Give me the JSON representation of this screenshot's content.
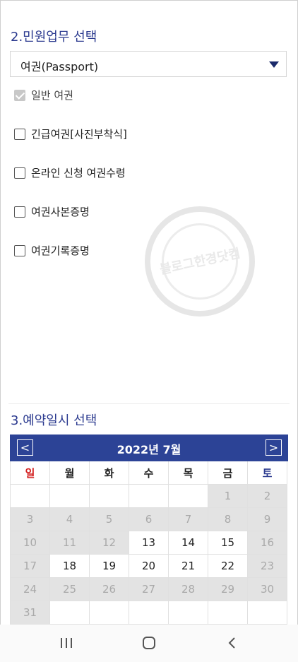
{
  "section2": {
    "title": "2.민원업무 선택",
    "select_value": "여권(Passport)",
    "options": [
      {
        "label": "일반 여권",
        "checked": true,
        "disabled": true
      },
      {
        "label": "긴급여권[사진부착식]",
        "checked": false,
        "disabled": false
      },
      {
        "label": "온라인 신청 여권수령",
        "checked": false,
        "disabled": false
      },
      {
        "label": "여권사본증명",
        "checked": false,
        "disabled": false
      },
      {
        "label": "여권기록증명",
        "checked": false,
        "disabled": false
      }
    ]
  },
  "watermark": {
    "text": "블로그한경닷컴"
  },
  "section3": {
    "title": "3.예약일시 선택",
    "calendar": {
      "month_label": "2022년 7월",
      "prev": "<",
      "next": ">",
      "weekdays": [
        "일",
        "월",
        "화",
        "수",
        "목",
        "금",
        "토"
      ],
      "weeks": [
        [
          {
            "d": "",
            "s": "empty"
          },
          {
            "d": "",
            "s": "empty"
          },
          {
            "d": "",
            "s": "empty"
          },
          {
            "d": "",
            "s": "empty"
          },
          {
            "d": "",
            "s": "empty"
          },
          {
            "d": "1",
            "s": "off"
          },
          {
            "d": "2",
            "s": "off"
          }
        ],
        [
          {
            "d": "3",
            "s": "off"
          },
          {
            "d": "4",
            "s": "off"
          },
          {
            "d": "5",
            "s": "off"
          },
          {
            "d": "6",
            "s": "off"
          },
          {
            "d": "7",
            "s": "off"
          },
          {
            "d": "8",
            "s": "off"
          },
          {
            "d": "9",
            "s": "off"
          }
        ],
        [
          {
            "d": "10",
            "s": "off"
          },
          {
            "d": "11",
            "s": "off"
          },
          {
            "d": "12",
            "s": "off"
          },
          {
            "d": "13",
            "s": "avail"
          },
          {
            "d": "14",
            "s": "avail"
          },
          {
            "d": "15",
            "s": "avail"
          },
          {
            "d": "16",
            "s": "off"
          }
        ],
        [
          {
            "d": "17",
            "s": "off"
          },
          {
            "d": "18",
            "s": "avail"
          },
          {
            "d": "19",
            "s": "avail"
          },
          {
            "d": "20",
            "s": "avail"
          },
          {
            "d": "21",
            "s": "avail"
          },
          {
            "d": "22",
            "s": "avail"
          },
          {
            "d": "23",
            "s": "off"
          }
        ],
        [
          {
            "d": "24",
            "s": "off"
          },
          {
            "d": "25",
            "s": "off"
          },
          {
            "d": "26",
            "s": "off"
          },
          {
            "d": "27",
            "s": "off"
          },
          {
            "d": "28",
            "s": "off"
          },
          {
            "d": "29",
            "s": "off"
          },
          {
            "d": "30",
            "s": "off"
          }
        ],
        [
          {
            "d": "31",
            "s": "off"
          },
          {
            "d": "",
            "s": "empty"
          },
          {
            "d": "",
            "s": "empty"
          },
          {
            "d": "",
            "s": "empty"
          },
          {
            "d": "",
            "s": "empty"
          },
          {
            "d": "",
            "s": "empty"
          },
          {
            "d": "",
            "s": "empty"
          }
        ]
      ]
    }
  },
  "navbar": {
    "icons": [
      "recent-apps-icon",
      "home-icon",
      "back-icon"
    ]
  },
  "colors": {
    "accent": "#2c4396",
    "title": "#2b3a8f",
    "sunday": "#d21c1c",
    "disabled_day": "#e3e3e3"
  }
}
